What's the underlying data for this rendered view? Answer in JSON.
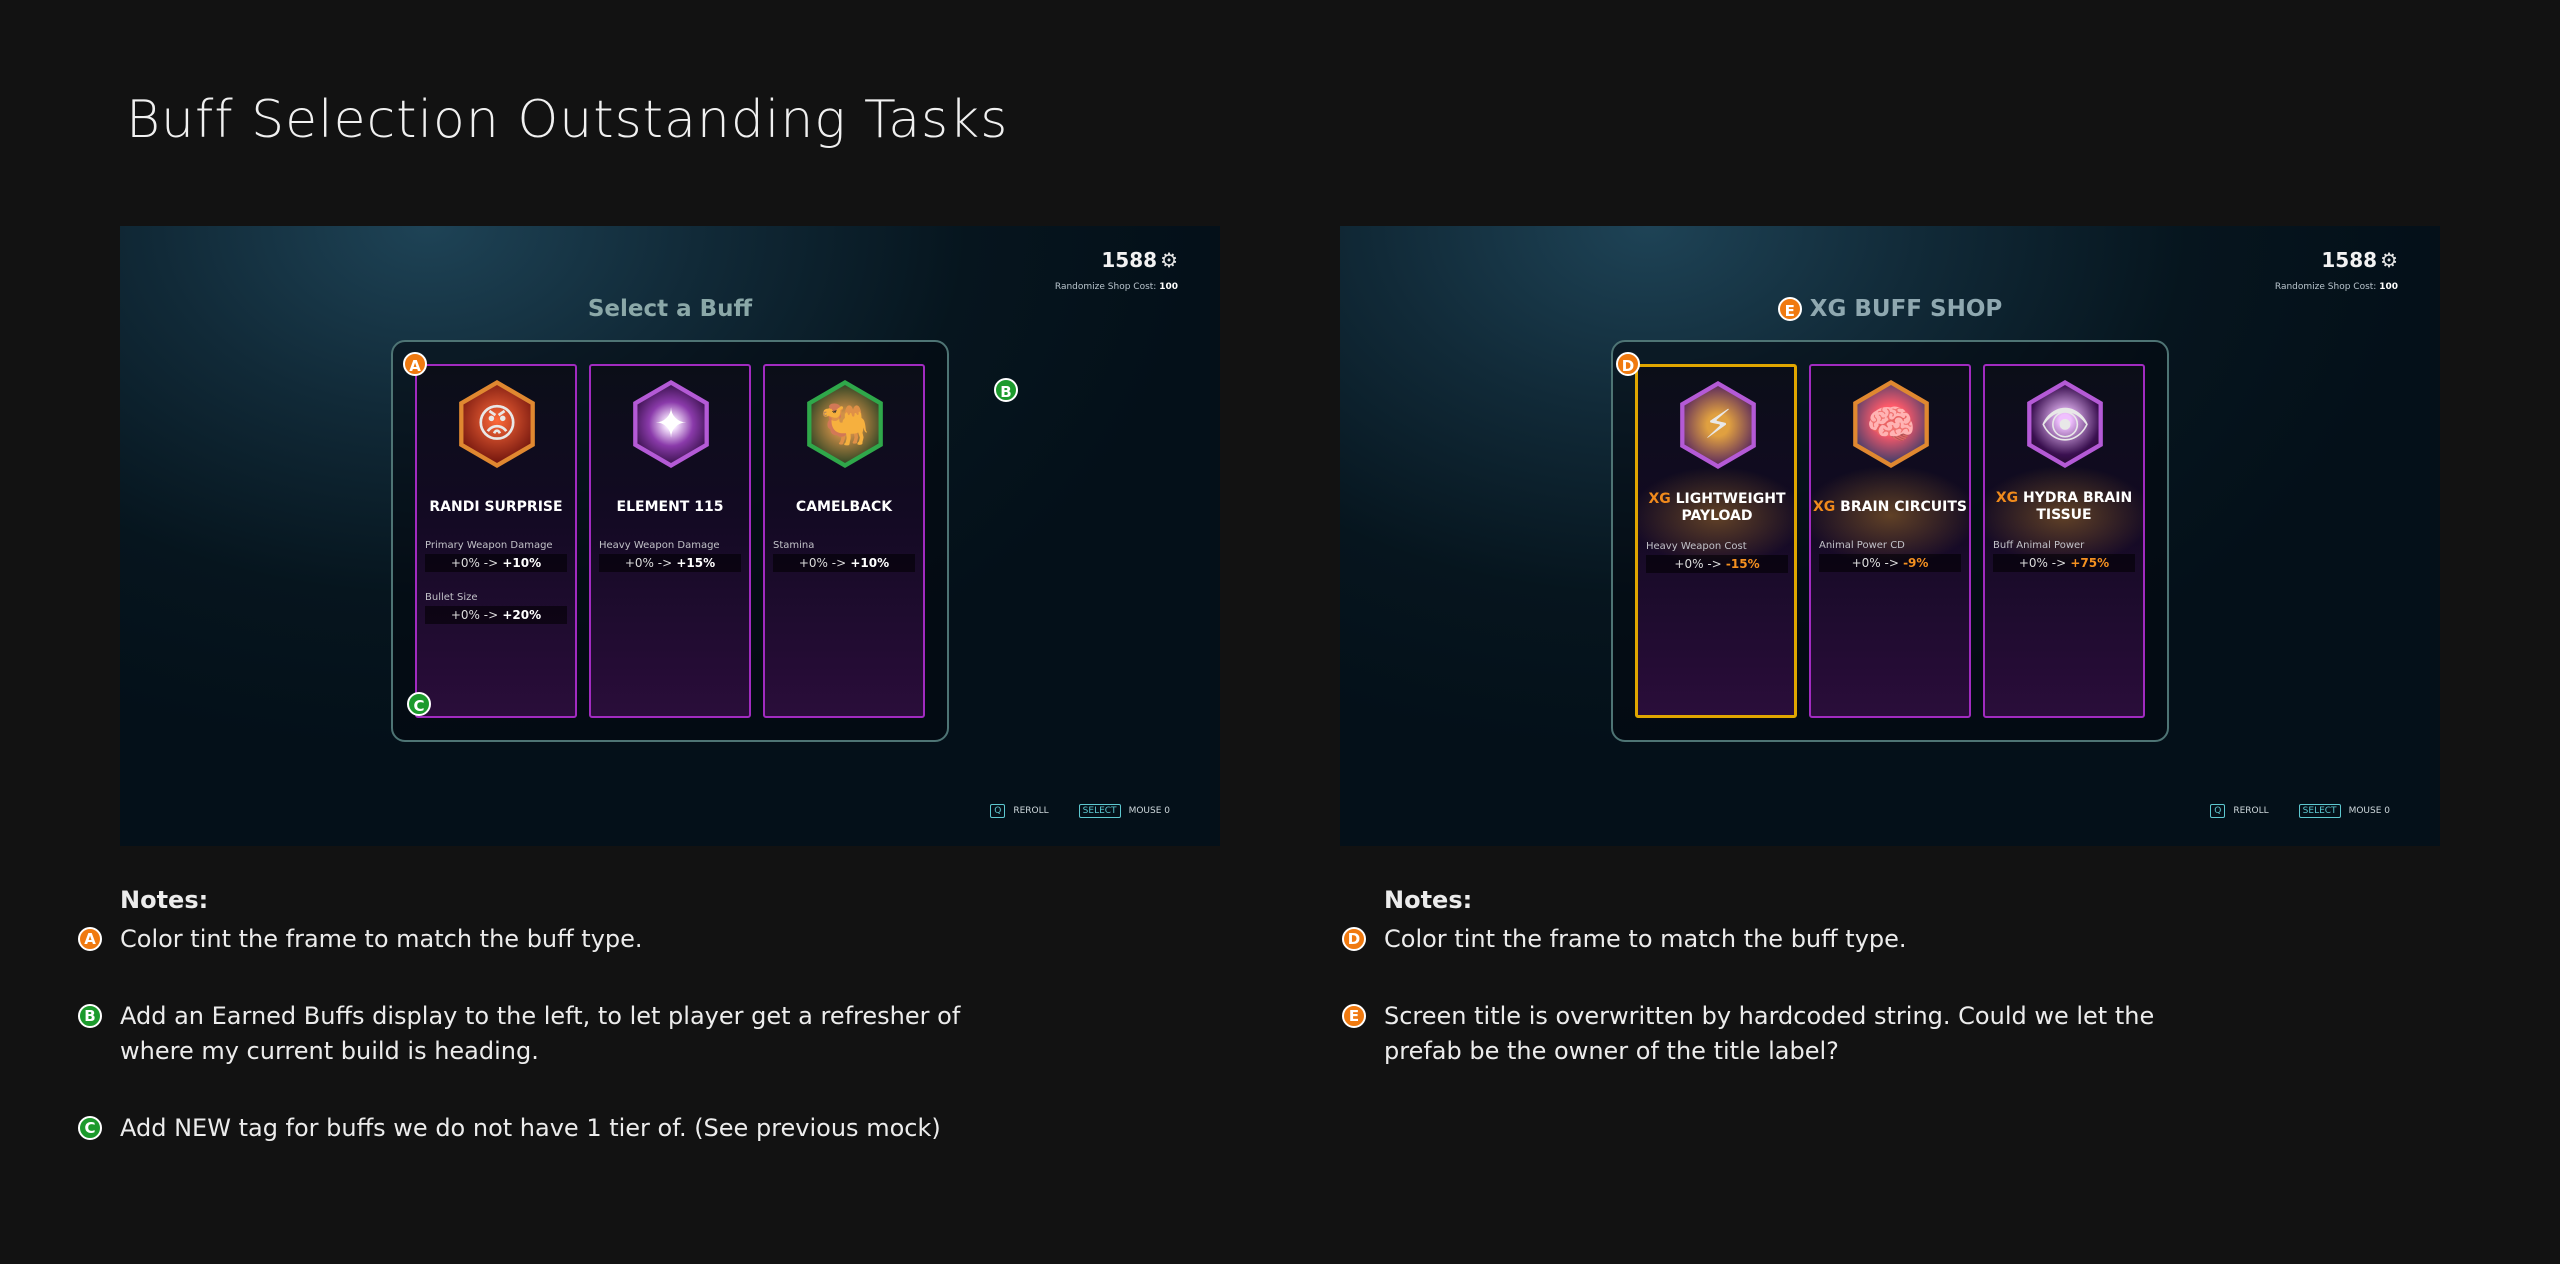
{
  "page_title": "Buff Selection Outstanding Tasks",
  "left_screen": {
    "currency": "1588",
    "reroll_cost_label": "Randomize Shop Cost:",
    "reroll_cost_value": "100",
    "title": "Select a Buff",
    "cards": [
      {
        "name": "RANDI SURPRISE",
        "icon": "randi-mascot-icon",
        "frame": "orange",
        "stats": [
          {
            "label": "Primary Weapon Damage",
            "base": "+0% ->",
            "value": "+10%"
          },
          {
            "label": "Bullet Size",
            "base": "+0% ->",
            "value": "+20%"
          }
        ]
      },
      {
        "name": "ELEMENT 115",
        "icon": "starburst-icon",
        "frame": "purple",
        "stats": [
          {
            "label": "Heavy Weapon Damage",
            "base": "+0% ->",
            "value": "+15%"
          }
        ]
      },
      {
        "name": "CAMELBACK",
        "icon": "camel-icon",
        "frame": "green",
        "stats": [
          {
            "label": "Stamina",
            "base": "+0% ->",
            "value": "+10%"
          }
        ]
      }
    ],
    "markers": {
      "a": "A",
      "b": "B",
      "c": "C"
    },
    "hints": {
      "reroll_key": "Q",
      "reroll_label": "REROLL",
      "select_key": "SELECT",
      "select_label": "MOUSE 0"
    }
  },
  "right_screen": {
    "currency": "1588",
    "reroll_cost_label": "Randomize Shop Cost:",
    "reroll_cost_value": "100",
    "title": "XG BUFF SHOP",
    "title_marker": "E",
    "cards": [
      {
        "prefix": "XG",
        "name_line1": "LIGHTWEIGHT",
        "name_line2": "PAYLOAD",
        "icon": "payload-icon",
        "frame": "purple",
        "selected": true,
        "stats": [
          {
            "label": "Heavy Weapon Cost",
            "base": "+0% ->",
            "value": "-15%"
          }
        ]
      },
      {
        "prefix": "XG",
        "name_line1": "BRAIN CIRCUITS",
        "name_line2": "",
        "icon": "brain-icon",
        "frame": "orange",
        "stats": [
          {
            "label": "Animal Power CD",
            "base": "+0% ->",
            "value": "-9%"
          }
        ]
      },
      {
        "prefix": "XG",
        "name_line1": "HYDRA BRAIN",
        "name_line2": "TISSUE",
        "icon": "hydra-icon",
        "frame": "purple",
        "stats": [
          {
            "label": "Buff Animal Power",
            "base": "+0% ->",
            "value": "+75%"
          }
        ]
      }
    ],
    "markers": {
      "d": "D"
    },
    "hints": {
      "reroll_key": "Q",
      "reroll_label": "REROLL",
      "select_key": "SELECT",
      "select_label": "MOUSE 0"
    }
  },
  "notes_left": {
    "heading": "Notes:",
    "items": [
      {
        "marker": "A",
        "color": "#f07a10",
        "text": "Color tint the frame to match the buff type."
      },
      {
        "marker": "B",
        "color": "#1c9a2c",
        "text": "Add an Earned Buffs display to the left, to let player get a refresher of where my current build is heading."
      },
      {
        "marker": "C",
        "color": "#1c9a2c",
        "text": "Add NEW tag for buffs we do not have 1 tier of. (See previous mock)"
      }
    ]
  },
  "notes_right": {
    "heading": "Notes:",
    "items": [
      {
        "marker": "D",
        "color": "#f07a10",
        "text": "Color tint the frame to match the buff type."
      },
      {
        "marker": "E",
        "color": "#f07a10",
        "text": "Screen title is overwritten by hardcoded string. Could we let the prefab be the owner of the title label?"
      }
    ]
  }
}
